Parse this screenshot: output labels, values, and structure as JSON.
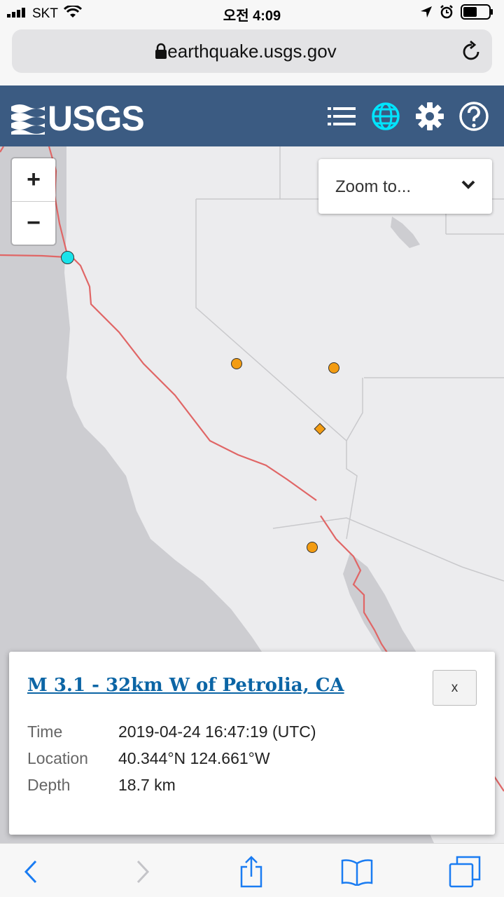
{
  "status_bar": {
    "carrier": "SKT",
    "time": "오전 4:09"
  },
  "browser": {
    "url": "earthquake.usgs.gov"
  },
  "header": {
    "logo_text": "USGS",
    "icons": [
      "list-icon",
      "globe-icon",
      "gear-icon",
      "help-icon"
    ],
    "accent_color": "#00e5ff",
    "background_color": "#3b5b82"
  },
  "map": {
    "zoom_in_label": "+",
    "zoom_out_label": "−",
    "zoom_to_label": "Zoom to...",
    "marker_colors": {
      "selected": "#19e3ea",
      "quake": "#f39c12"
    },
    "fault_line_color": "#e06666"
  },
  "popup": {
    "title": "M 3.1 - 32km W of Petrolia, CA",
    "close_label": "x",
    "rows": [
      {
        "label": "Time",
        "value": "2019-04-24 16:47:19 (UTC)"
      },
      {
        "label": "Location",
        "value": "40.344°N 124.661°W"
      },
      {
        "label": "Depth",
        "value": "18.7 km"
      }
    ]
  },
  "toolbar": {
    "icons": [
      "back-icon",
      "forward-icon",
      "share-icon",
      "bookmarks-icon",
      "tabs-icon"
    ]
  }
}
